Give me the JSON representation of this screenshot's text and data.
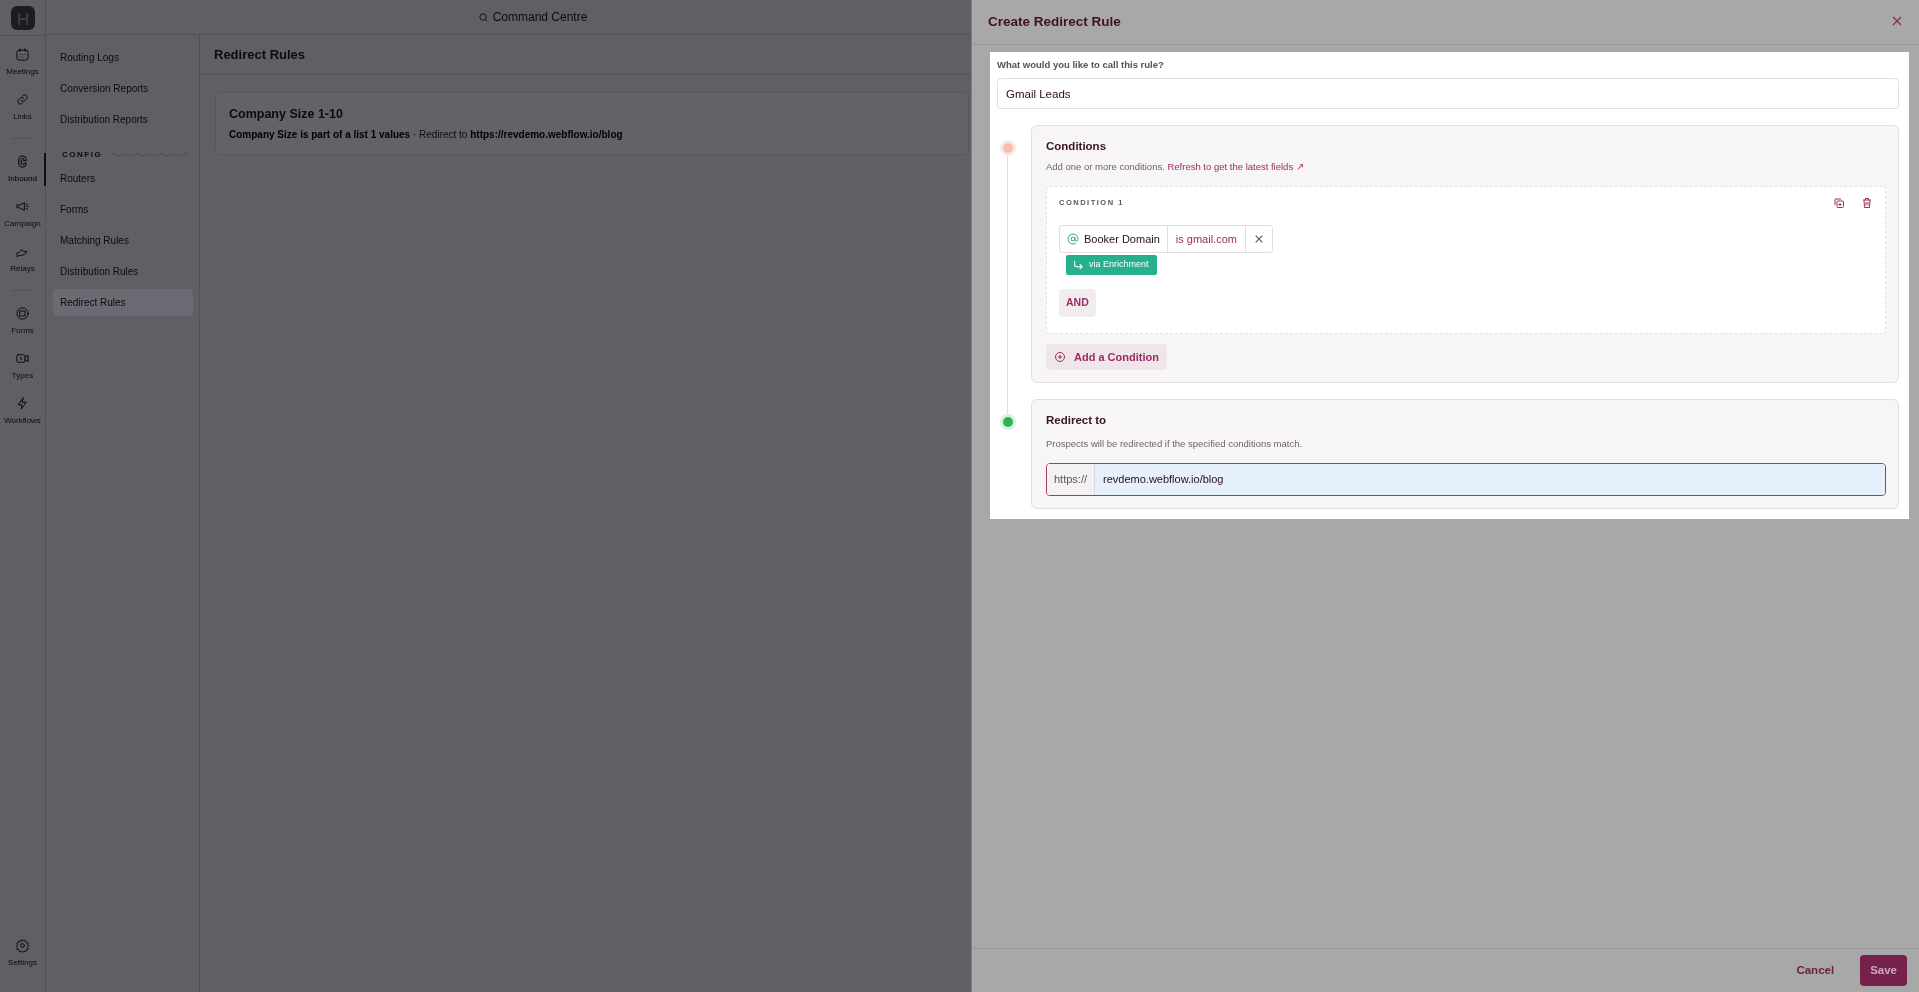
{
  "rail": {
    "groups": [
      {
        "items": [
          {
            "label": "Meetings",
            "selected": false
          },
          {
            "label": "Links",
            "selected": false
          }
        ]
      },
      {
        "items": [
          {
            "label": "Inbound",
            "selected": true
          },
          {
            "label": "Campaign",
            "selected": false
          },
          {
            "label": "Relays",
            "selected": false
          }
        ]
      },
      {
        "items": [
          {
            "label": "Forms",
            "selected": false
          },
          {
            "label": "Types",
            "selected": false
          },
          {
            "label": "Workflows",
            "selected": false
          }
        ]
      }
    ],
    "settings": {
      "label": "Settings"
    }
  },
  "topbar": {
    "command_search": "Command Centre"
  },
  "subnav": {
    "sections": [
      {
        "items": [
          {
            "label": "Routing Logs",
            "selected": false
          },
          {
            "label": "Conversion Reports",
            "selected": false
          },
          {
            "label": "Distribution Reports",
            "selected": false
          }
        ]
      },
      {
        "heading": "CONFIG",
        "items": [
          {
            "label": "Routers",
            "selected": false
          },
          {
            "label": "Forms",
            "selected": false
          },
          {
            "label": "Matching Rules",
            "selected": false
          },
          {
            "label": "Distribution Rules",
            "selected": false
          },
          {
            "label": "Redirect Rules",
            "selected": true
          }
        ]
      }
    ]
  },
  "page": {
    "title": "Redirect Rules",
    "rules": [
      {
        "title": "Company Size 1-10",
        "description": "**Company Size is part of a list 1 values** · Redirect to **https://revdemo.webflow.io/blog**"
      }
    ]
  },
  "drawer": {
    "title": "Create Redirect Rule",
    "name_label": "What would you like to call this rule?",
    "name_value": "Gmail Leads",
    "conditions": {
      "done": false,
      "title": "Conditions",
      "hint": "Add one or more conditions.",
      "refresh_link": "Refresh to get the latest fields ↗",
      "groups": [
        {
          "label": "CONDITION 1",
          "conditions": [
            {
              "field": "Booker Domain",
              "operator": "is gmail.com",
              "source": "via Enrichment"
            }
          ],
          "join": "AND"
        }
      ],
      "add_button": "Add a Condition"
    },
    "redirect": {
      "done": true,
      "title": "Redirect to",
      "hint": "Prospects will be redirected if the specified conditions match.",
      "prefix": "https://",
      "value": "revdemo.webflow.io/blog",
      "focused": true
    },
    "footer": {
      "cancel": "Cancel",
      "save": "Save"
    }
  }
}
